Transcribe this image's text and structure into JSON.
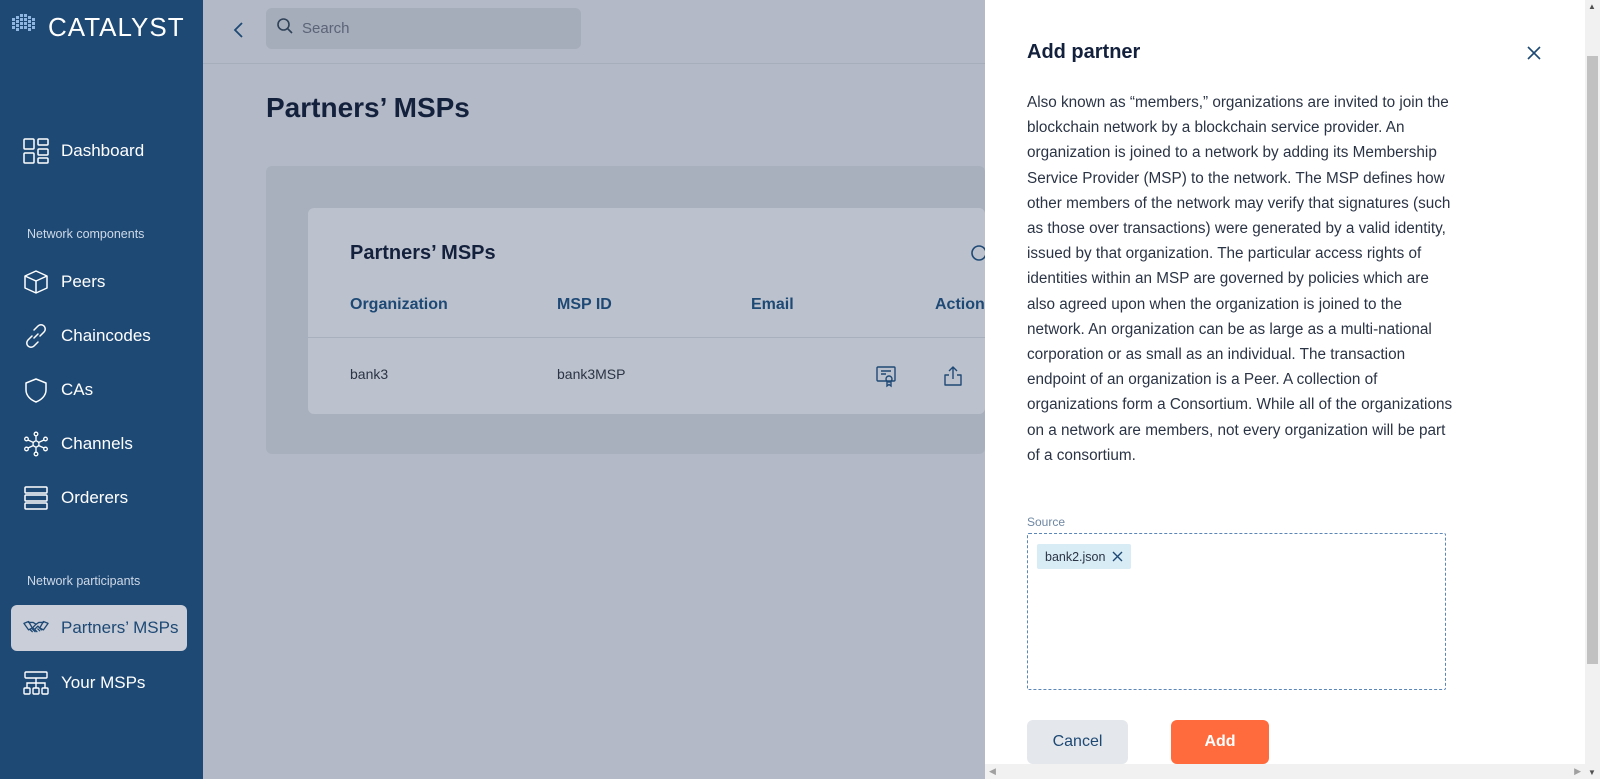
{
  "app": {
    "logo_text": "CATALYST"
  },
  "sidebar": {
    "dashboard": "Dashboard",
    "section_components": "Network components",
    "peers": "Peers",
    "chaincodes": "Chaincodes",
    "cas": "CAs",
    "channels": "Channels",
    "orderers": "Orderers",
    "section_participants": "Network participants",
    "partners_msps": "Partners’ MSPs",
    "your_msps": "Your MSPs"
  },
  "topbar": {
    "search_placeholder": "Search"
  },
  "page": {
    "title": "Partners’ MSPs"
  },
  "table": {
    "title": "Partners’ MSPs",
    "headers": {
      "organization": "Organization",
      "msp_id": "MSP ID",
      "email": "Email",
      "actions": "Action"
    },
    "rows": [
      {
        "organization": "bank3",
        "msp_id": "bank3MSP",
        "email": ""
      }
    ]
  },
  "drawer": {
    "title": "Add partner",
    "description": "Also known as “members,” organizations are invited to join the blockchain network by a blockchain service provider. An organization is joined to a network by adding its Membership Service Provider (MSP) to the network. The MSP defines how other members of the network may verify that signatures (such as those over transactions) were generated by a valid identity, issued by that organization. The particular access rights of identities within an MSP are governed by policies which are also agreed upon when the organization is joined to the network. An organization can be as large as a multi-national corporation or as small as an individual. The transaction endpoint of an organization is a Peer. A collection of organizations form a Consortium. While all of the organizations on a network are members, not every organization will be part of a consortium.",
    "source_label": "Source",
    "file_chip": "bank2.json",
    "cancel_label": "Cancel",
    "add_label": "Add"
  },
  "colors": {
    "sidebar_bg": "#1e4975",
    "accent_orange": "#ff6b3d",
    "overlay_bg": "#b3b9c6",
    "chip_bg": "#d8ecf5"
  }
}
